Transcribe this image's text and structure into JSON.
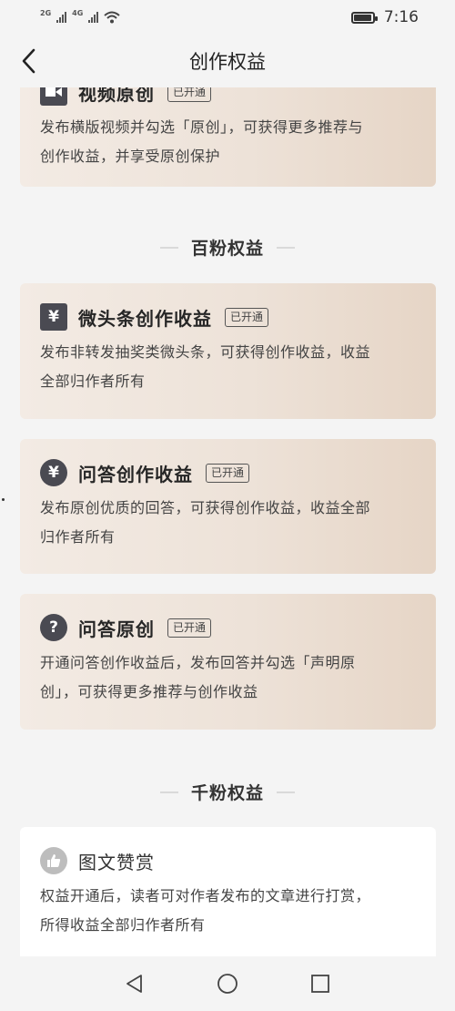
{
  "status_bar": {
    "network_1": "2G",
    "network_2": "4G",
    "time": "7:16",
    "battery_level": 0.95
  },
  "header": {
    "title": "创作权益",
    "back_icon": "chevron-left-icon"
  },
  "cards_top": [
    {
      "title": "视频原创",
      "badge": "已开通",
      "icon": "video-icon",
      "desc_line1": "发布横版视频并勾选「原创」，可获得更多推荐与",
      "desc_line2": "创作收益，并享受原创保护"
    }
  ],
  "sections": [
    {
      "title": "百粉权益",
      "cards": [
        {
          "title": "微头条创作收益",
          "badge": "已开通",
          "icon": "yuan-icon",
          "desc_line1": "发布非转发抽奖类微头条，可获得创作收益，收益",
          "desc_line2": "全部归作者所有"
        },
        {
          "title": "问答创作收益",
          "badge": "已开通",
          "icon": "yuan-circle-icon",
          "desc_line1": "发布原创优质的回答，可获得创作收益，收益全部",
          "desc_line2": "归作者所有"
        },
        {
          "title": "问答原创",
          "badge": "已开通",
          "icon": "question-icon",
          "desc_line1": "开通问答创作收益后，发布回答并勾选「声明原",
          "desc_line2": "创」，可获得更多推荐与创作收益"
        }
      ]
    },
    {
      "title": "千粉权益",
      "cards": [
        {
          "title": "图文赞赏",
          "icon": "thumbs-up-icon",
          "desc_line1": "权益开通后，读者可对作者发布的文章进行打赏，",
          "desc_line2": "所得收益全部归作者所有"
        }
      ]
    }
  ],
  "nav": {
    "back": "nav-back-icon",
    "home": "nav-home-icon",
    "recent": "nav-recent-icon"
  },
  "colors": {
    "card_start": "#f3ebe4",
    "card_end": "#e6d5c6",
    "icon_dark": "#4a4a52",
    "background": "#f4f4f4"
  }
}
